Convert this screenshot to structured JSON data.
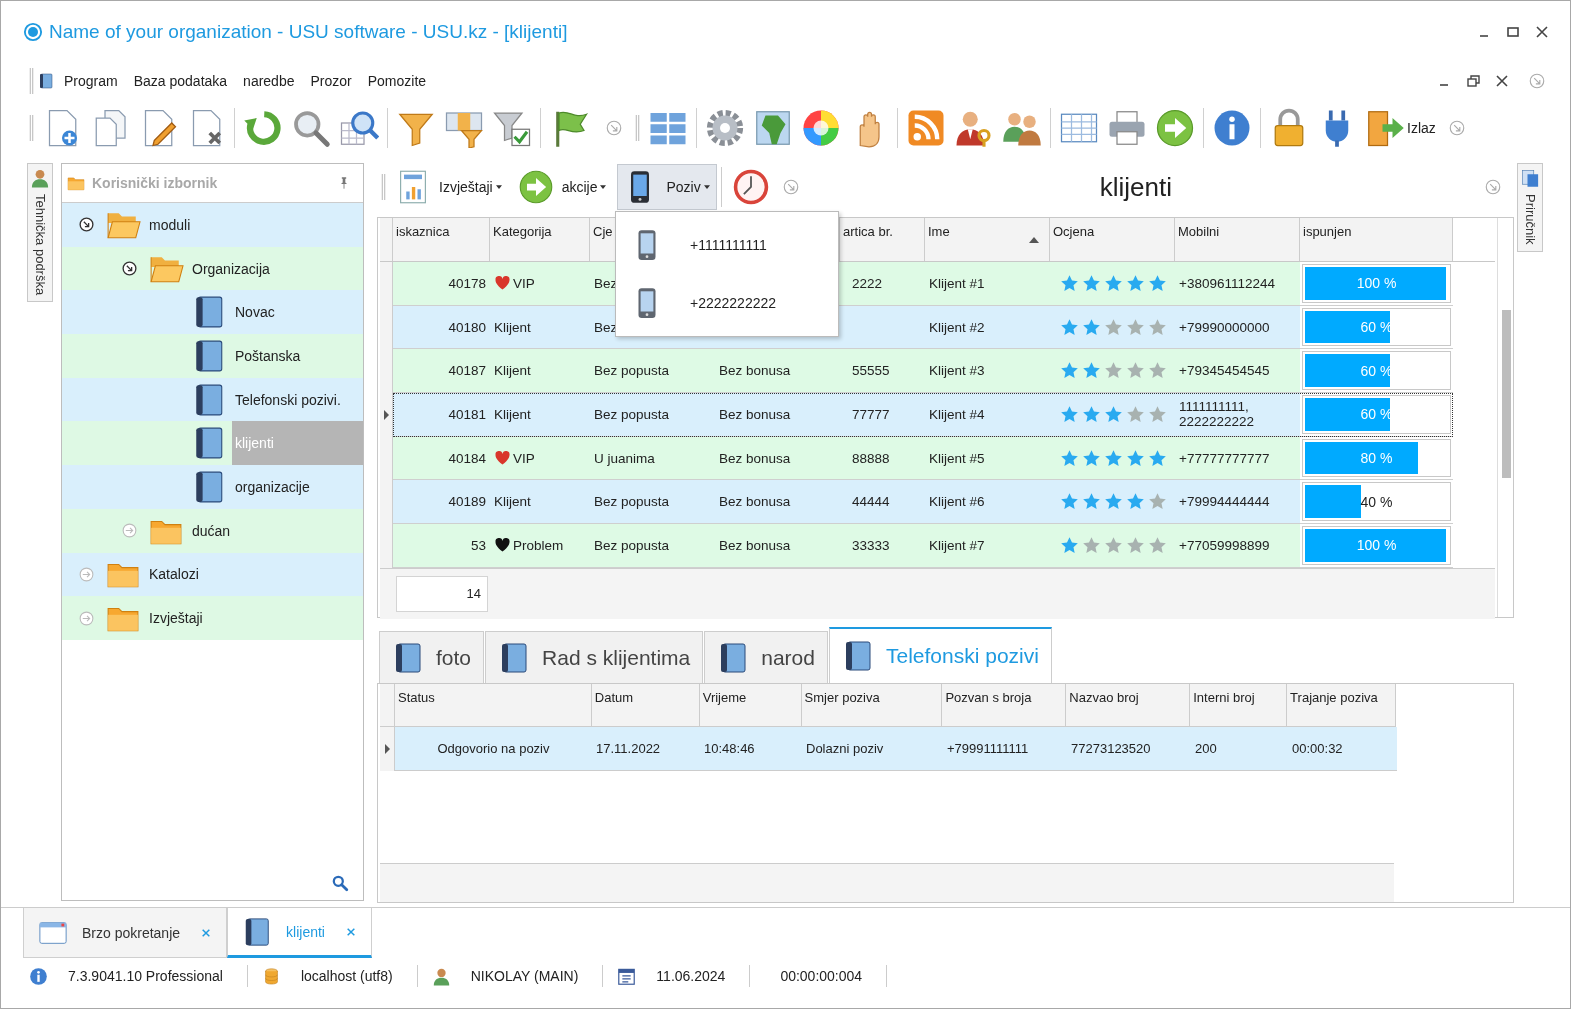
{
  "window": {
    "title": "Name of your organization - USU software - USU.kz - [klijenti]"
  },
  "menu": [
    "Program",
    "Baza podataka",
    "naredbe",
    "Prozor",
    "Pomozite"
  ],
  "toolbar": {
    "exit_label": "Izlaz"
  },
  "side_tabs": {
    "left": "Tehnička podrška",
    "right": "Priručnik"
  },
  "tree": {
    "title": "Korisnički izbornik",
    "items": [
      {
        "label": "moduli",
        "kind": "folder",
        "expanded": true,
        "selected": false,
        "children": [
          {
            "label": "Organizacija",
            "kind": "folder",
            "expanded": true,
            "selected": false,
            "children": [
              {
                "label": "Novac",
                "kind": "module",
                "selected": false
              },
              {
                "label": "Poštanska",
                "kind": "module",
                "selected": false
              },
              {
                "label": "Telefonski pozivi.",
                "kind": "module",
                "selected": false
              },
              {
                "label": "klijenti",
                "kind": "module",
                "selected": true
              },
              {
                "label": "organizacije",
                "kind": "module",
                "selected": false
              }
            ]
          },
          {
            "label": "dućan",
            "kind": "folder",
            "expanded": false,
            "selected": false
          }
        ]
      },
      {
        "label": "Katalozi",
        "kind": "folder",
        "expanded": false,
        "selected": false
      },
      {
        "label": "Izvještaji",
        "kind": "folder",
        "expanded": false,
        "selected": false
      }
    ]
  },
  "content": {
    "title": "klijenti",
    "actions": [
      {
        "label": "Izvještaji",
        "kind": "report",
        "pressed": false
      },
      {
        "label": "akcije",
        "kind": "action",
        "pressed": false
      },
      {
        "label": "Poziv",
        "kind": "phone",
        "pressed": true
      }
    ],
    "call_menu": {
      "items": [
        "+1111111111",
        "+2222222222"
      ]
    },
    "grid": {
      "columns": [
        {
          "label": "iskaznica"
        },
        {
          "label": "Kategorija"
        },
        {
          "label": "Cje"
        },
        {},
        {
          "label": "artica br."
        },
        {
          "label": "Ime",
          "sorted": true
        },
        {
          "label": "Ocjena"
        },
        {
          "label": "Mobilni"
        },
        {
          "label": "ispunjen"
        }
      ],
      "rows": [
        {
          "id": "40178",
          "category": {
            "label": "VIP",
            "color": "#d9362b"
          },
          "price": "Bez",
          "card": "2222",
          "name": "Klijent #1",
          "stars": 5,
          "mobile": "+380961112244",
          "level": 1.0,
          "progress": "100 %",
          "selected": false
        },
        {
          "id": "40180",
          "category": {
            "label": "Klijent"
          },
          "price": "Bez",
          "name": "Klijent #2",
          "stars": 2,
          "mobile": "+79990000000",
          "level": 0.6,
          "progress": "60 %",
          "selected": false
        },
        {
          "id": "40187",
          "category": {
            "label": "Klijent"
          },
          "price": "Bez popusta",
          "bonus": "Bez bonusa",
          "card": "55555",
          "name": "Klijent #3",
          "stars": 2,
          "mobile": "+79345454545",
          "level": 0.6,
          "progress": "60 %",
          "selected": false
        },
        {
          "id": "40181",
          "category": {
            "label": "Klijent"
          },
          "price": "Bez popusta",
          "bonus": "Bez bonusa",
          "card": "77777",
          "name": "Klijent #4",
          "stars": 3,
          "mobile": "1111111111, 2222222222",
          "level": 0.6,
          "progress": "60 %",
          "selected": true
        },
        {
          "id": "40184",
          "category": {
            "label": "VIP",
            "color": "#d9362b"
          },
          "price": "U juanima",
          "bonus": "Bez bonusa",
          "card": "88888",
          "name": "Klijent #5",
          "stars": 5,
          "mobile": "+77777777777",
          "level": 0.8,
          "progress": "80 %",
          "selected": false
        },
        {
          "id": "40189",
          "category": {
            "label": "Klijent"
          },
          "price": "Bez popusta",
          "bonus": "Bez bonusa",
          "card": "44444",
          "name": "Klijent #6",
          "stars": 4,
          "mobile": "+79994444444",
          "level": 0.4,
          "progress": "40 %",
          "selected": false
        },
        {
          "id": "53",
          "category": {
            "label": "Problem",
            "color": "#111111"
          },
          "price": "Bez popusta",
          "bonus": "Bez bonusa",
          "card": "33333",
          "name": "Klijent #7",
          "stars": 1,
          "mobile": "+77059998899",
          "level": 1.0,
          "progress": "100 %",
          "selected": false
        }
      ],
      "footer": "14"
    },
    "detail_tabs": [
      {
        "label": "foto",
        "selected": false
      },
      {
        "label": "Rad s klijentima",
        "selected": false
      },
      {
        "label": "narod",
        "selected": false
      },
      {
        "label": "Telefonski pozivi",
        "selected": true
      }
    ],
    "calls": {
      "columns": [
        "Status",
        "Datum",
        "Vrijeme",
        "Smjer poziva",
        "Pozvan s broja",
        "Nazvao broj",
        "Interni broj",
        "Trajanje poziva"
      ],
      "rows": [
        {
          "cells": [
            "Odgovorio na poziv",
            "17.11.2022",
            "10:48:46",
            "Dolazni poziv",
            "+79991111111",
            "77273123520",
            "200",
            "00:00:32"
          ],
          "selected": true
        }
      ]
    }
  },
  "document_tabs": [
    {
      "label": "Brzo pokretanje",
      "kind": "window",
      "selected": false
    },
    {
      "label": "klijenti",
      "kind": "module",
      "selected": true
    }
  ],
  "status_bar": [
    {
      "kind": "info",
      "text": "7.3.9041.10 Professional"
    },
    {
      "kind": "database",
      "text": "localhost (utf8)"
    },
    {
      "kind": "user",
      "text": "NIKOLAY (MAIN)"
    },
    {
      "kind": "calendar",
      "text": "11.06.2024"
    },
    {
      "kind": "plain",
      "text": "00:00:00:004"
    }
  ]
}
